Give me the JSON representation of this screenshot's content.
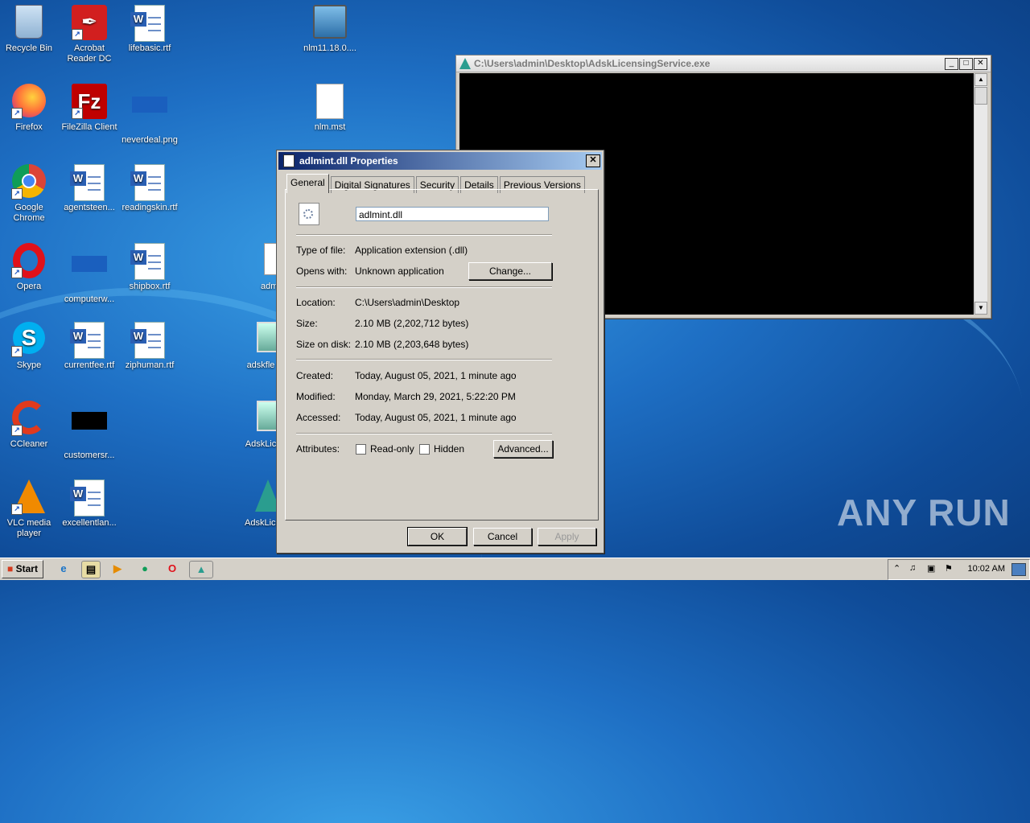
{
  "desktop": {
    "icons": [
      {
        "label": "Recycle Bin"
      },
      {
        "label": "Acrobat Reader DC"
      },
      {
        "label": "lifebasic.rtf"
      },
      {
        "label": "nlm11.18.0...."
      },
      {
        "label": "Firefox"
      },
      {
        "label": "FileZilla Client"
      },
      {
        "label": "neverdeal.png"
      },
      {
        "label": "nlm.mst"
      },
      {
        "label": "Google Chrome"
      },
      {
        "label": "agentsteen..."
      },
      {
        "label": "readingskin.rtf"
      },
      {
        "label": "Opera"
      },
      {
        "label": "computerw..."
      },
      {
        "label": "shipbox.rtf"
      },
      {
        "label": "admin"
      },
      {
        "label": "Skype"
      },
      {
        "label": "currentfee.rtf"
      },
      {
        "label": "ziphuman.rtf"
      },
      {
        "label": "adskfle"
      },
      {
        "label": "CCleaner"
      },
      {
        "label": "customersr..."
      },
      {
        "label": "AdskLic"
      },
      {
        "label": "VLC media player"
      },
      {
        "label": "excellentlan..."
      },
      {
        "label": "AdskLice"
      }
    ]
  },
  "console": {
    "title": "C:\\Users\\admin\\Desktop\\AdskLicensingService.exe"
  },
  "dialog": {
    "title": "adlmint.dll Properties",
    "tabs": [
      "General",
      "Digital Signatures",
      "Security",
      "Details",
      "Previous Versions"
    ],
    "filename": "adlmint.dll",
    "type_label": "Type of file:",
    "type_value": "Application extension (.dll)",
    "opens_label": "Opens with:",
    "opens_value": "Unknown application",
    "change_button": "Change...",
    "location_label": "Location:",
    "location_value": "C:\\Users\\admin\\Desktop",
    "size_label": "Size:",
    "size_value": "2.10 MB (2,202,712 bytes)",
    "size_disk_label": "Size on disk:",
    "size_disk_value": "2.10 MB (2,203,648 bytes)",
    "created_label": "Created:",
    "created_value": "Today, August 05, 2021, 1 minute ago",
    "modified_label": "Modified:",
    "modified_value": "Monday, March 29, 2021, 5:22:20 PM",
    "accessed_label": "Accessed:",
    "accessed_value": "Today, August 05, 2021, 1 minute ago",
    "attributes_label": "Attributes:",
    "readonly_label": "Read-only",
    "hidden_label": "Hidden",
    "advanced_button": "Advanced...",
    "ok_button": "OK",
    "cancel_button": "Cancel",
    "apply_button": "Apply"
  },
  "taskbar": {
    "start_label": "Start",
    "clock": "10:02 AM"
  },
  "watermark": "ANY RUN"
}
